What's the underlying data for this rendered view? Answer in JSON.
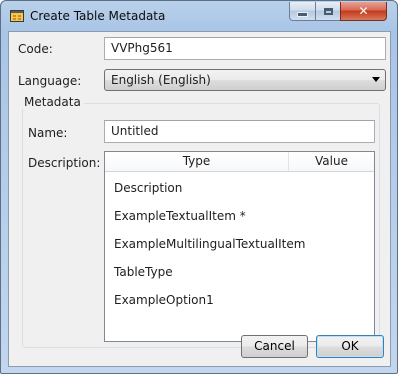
{
  "window": {
    "title": "Create Table Metadata",
    "close_glyph": "✕"
  },
  "form": {
    "code_label": "Code:",
    "code_value": "VVPhg561",
    "language_label": "Language:",
    "language_value": "English (English)"
  },
  "metadata": {
    "group_title": "Metadata",
    "name_label": "Name:",
    "name_value": "Untitled",
    "description_label": "Description:",
    "columns": [
      "Type",
      "Value"
    ],
    "rows": [
      "Description",
      "ExampleTextualItem *",
      "ExampleMultilingualTextualItem",
      "TableType",
      "ExampleOption1"
    ]
  },
  "buttons": {
    "cancel": "Cancel",
    "ok": "OK"
  },
  "icons": {
    "app": "table-window-icon",
    "minimize": "minimize-icon",
    "maximize": "maximize-icon",
    "close": "close-icon",
    "dropdown": "chevron-down-icon"
  }
}
